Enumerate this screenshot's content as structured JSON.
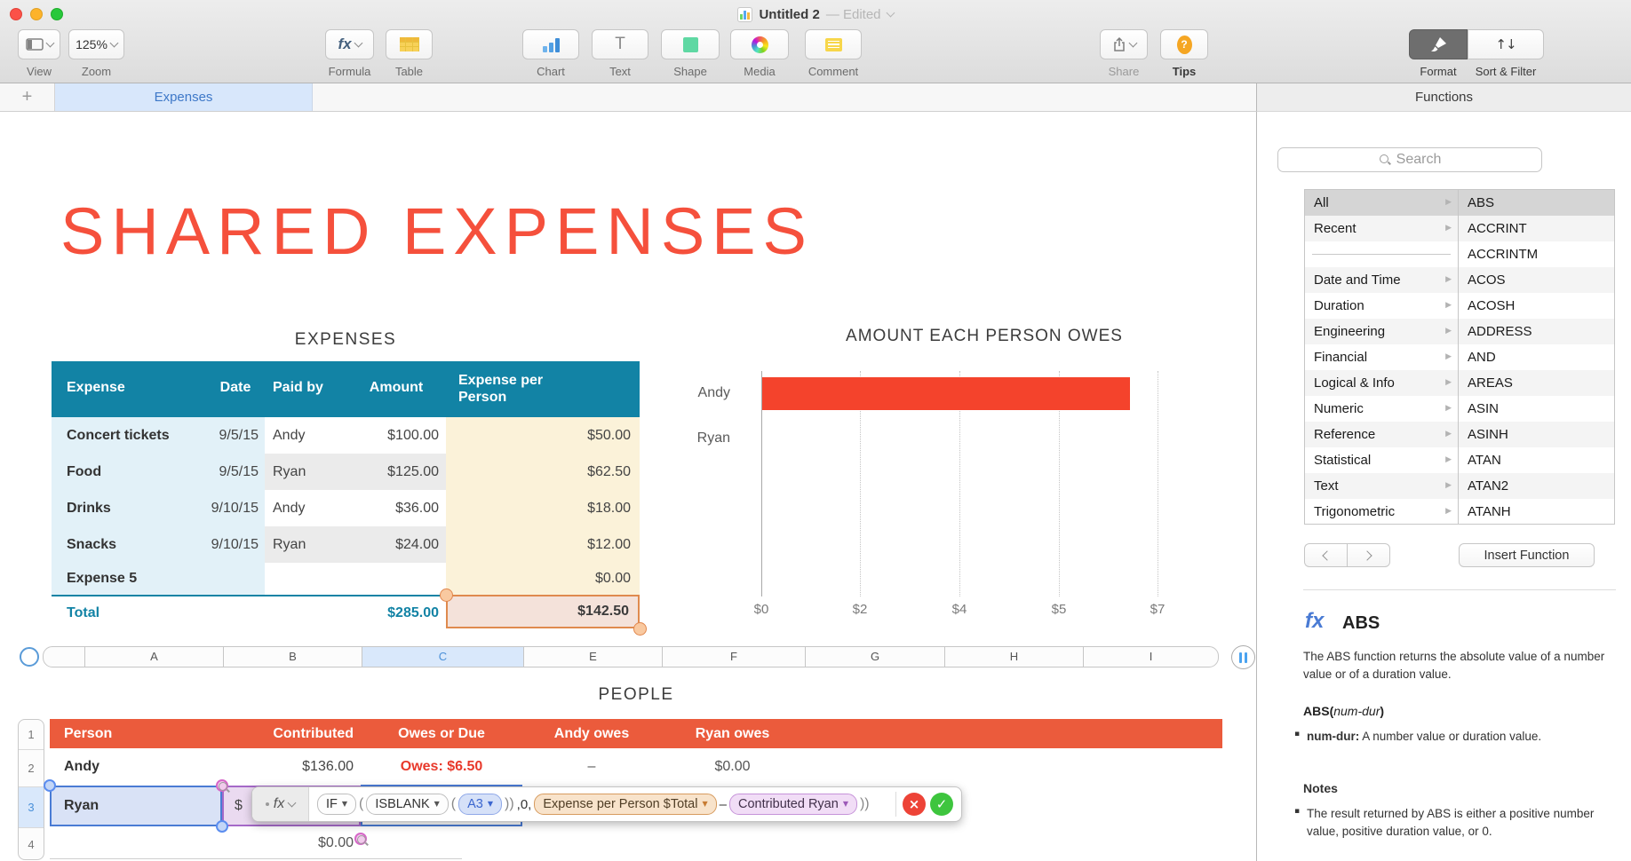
{
  "window": {
    "title": "Untitled 2",
    "status": "— Edited"
  },
  "toolbar": {
    "view": "View",
    "zoom_value": "125%",
    "zoom": "Zoom",
    "formula_glyph": "fx",
    "formula": "Formula",
    "table": "Table",
    "chart": "Chart",
    "text_glyph": "T",
    "text": "Text",
    "shape": "Shape",
    "media": "Media",
    "comment": "Comment",
    "share": "Share",
    "tips_glyph": "?",
    "tips": "Tips",
    "format": "Format",
    "sort_glyph": "↑↓",
    "sort_filter": "Sort & Filter"
  },
  "tab_bar": {
    "add": "+",
    "tabs": [
      {
        "label": "Expenses"
      }
    ]
  },
  "canvas": {
    "heading": "SHARED EXPENSES",
    "expenses": {
      "title": "EXPENSES",
      "headers": [
        "Expense",
        "Date",
        "Paid by",
        "Amount",
        "Expense per Person"
      ],
      "rows": [
        [
          "Concert tickets",
          "9/5/15",
          "Andy",
          "$100.00",
          "$50.00"
        ],
        [
          "Food",
          "9/5/15",
          "Ryan",
          "$125.00",
          "$62.50"
        ],
        [
          "Drinks",
          "9/10/15",
          "Andy",
          "$36.00",
          "$18.00"
        ],
        [
          "Snacks",
          "9/10/15",
          "Ryan",
          "$24.00",
          "$12.00"
        ],
        [
          "Expense 5",
          "",
          "",
          "",
          "$0.00"
        ]
      ],
      "total": {
        "label": "Total",
        "amount": "$285.00",
        "per_person": "$142.50"
      }
    },
    "chart": {
      "title": "AMOUNT EACH PERSON OWES",
      "categories": [
        "Andy",
        "Ryan"
      ],
      "x_ticks": [
        "$0",
        "$2",
        "$4",
        "$5",
        "$7"
      ]
    },
    "column_refs": [
      "A",
      "B",
      "C",
      "E",
      "F",
      "G",
      "H",
      "I"
    ],
    "row_refs": [
      "1",
      "2",
      "3",
      "4"
    ],
    "people": {
      "title": "PEOPLE",
      "headers": [
        "Person",
        "Contributed",
        "Owes or Due",
        "Andy owes",
        "Ryan owes"
      ],
      "andy_row": [
        "Andy",
        "$136.00",
        "Owes: $6.50",
        "–",
        "$0.00"
      ],
      "ryan_person": "Ryan",
      "ryan_contributed_partial": "$",
      "row4_contributed": "$0.00"
    },
    "formula_editor": {
      "fx": "fx",
      "caret": "▼",
      "if": "IF",
      "isblank": "ISBLANK",
      "a3": "A3",
      "open": "(",
      "close": ")",
      "zero": ",0,",
      "total_token": "Expense per Person $Total",
      "minus": "–",
      "contributed_token": "Contributed Ryan",
      "close2": "))",
      "cancel_glyph": "×",
      "accept_glyph": "✓"
    }
  },
  "chart_data": {
    "type": "bar",
    "orientation": "horizontal",
    "title": "AMOUNT EACH PERSON OWES",
    "categories": [
      "Andy",
      "Ryan"
    ],
    "values": [
      6.5,
      0
    ],
    "x_tick_labels": [
      "$0",
      "$2",
      "$4",
      "$5",
      "$7"
    ],
    "xlim": [
      0,
      7
    ],
    "bar_color": "#F4432C",
    "grid": "vertical-dotted-gridlines",
    "legend": "none"
  },
  "functions_panel": {
    "title": "Functions",
    "search_placeholder": "Search",
    "row_arrow": "▶",
    "categories": [
      "All",
      "Recent",
      "",
      "Date and Time",
      "Duration",
      "Engineering",
      "Financial",
      "Logical & Info",
      "Numeric",
      "Reference",
      "Statistical",
      "Text",
      "Trigonometric"
    ],
    "functions": [
      "ABS",
      "ACCRINT",
      "ACCRINTM",
      "ACOS",
      "ACOSH",
      "ADDRESS",
      "AND",
      "AREAS",
      "ASIN",
      "ASINH",
      "ATAN",
      "ATAN2",
      "ATANH"
    ],
    "insert_button": "Insert Function",
    "doc": {
      "icon": "fx",
      "name": "ABS",
      "description": "The ABS function returns the absolute value of a number value or of a duration value.",
      "sig_name": "ABS",
      "sig_open": "(",
      "sig_arg": "num-dur",
      "sig_close": ")",
      "bullet": "▪",
      "arg_term": "num-dur:",
      "arg_desc": " A number value or duration value.",
      "notes_label": "Notes",
      "note": "The result returned by ABS is either a positive number value, positive duration value, or 0."
    }
  }
}
